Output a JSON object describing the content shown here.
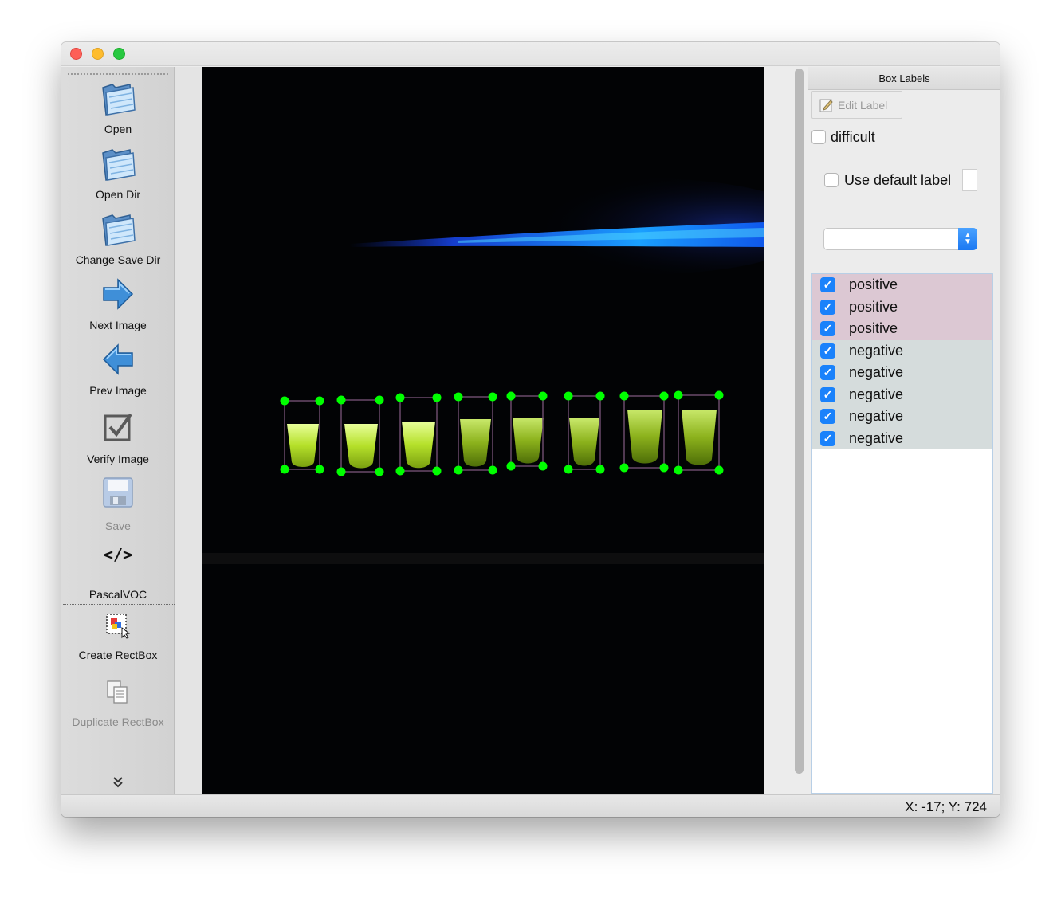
{
  "toolbar": {
    "open": "Open",
    "open_dir": "Open Dir",
    "change_save_dir": "Change Save Dir",
    "next_image": "Next Image",
    "prev_image": "Prev Image",
    "verify_image": "Verify Image",
    "save": "Save",
    "format": "PascalVOC",
    "create_rectbox": "Create RectBox",
    "duplicate_rectbox": "Duplicate RectBox",
    "format_icon_text": "</>"
  },
  "dock": {
    "title": "Box Labels",
    "edit_label": "Edit Label",
    "difficult": "difficult",
    "use_default_label": "Use default label",
    "labels": [
      {
        "text": "positive",
        "kind": "positive",
        "checked": true
      },
      {
        "text": "positive",
        "kind": "positive",
        "checked": true
      },
      {
        "text": "positive",
        "kind": "positive",
        "checked": true
      },
      {
        "text": "negative",
        "kind": "negative",
        "checked": true
      },
      {
        "text": "negative",
        "kind": "negative",
        "checked": true
      },
      {
        "text": "negative",
        "kind": "negative",
        "checked": true
      },
      {
        "text": "negative",
        "kind": "negative",
        "checked": true
      },
      {
        "text": "negative",
        "kind": "negative",
        "checked": true
      }
    ],
    "check_glyph": "✓"
  },
  "status": {
    "coords": "X: -17; Y: 724"
  },
  "colors": {
    "handle": "#00ff00",
    "box_outline": "#6b4a6b",
    "positive_row": "#dcc8d3",
    "negative_row": "#d5dcdc",
    "accent": "#1a82fb"
  }
}
